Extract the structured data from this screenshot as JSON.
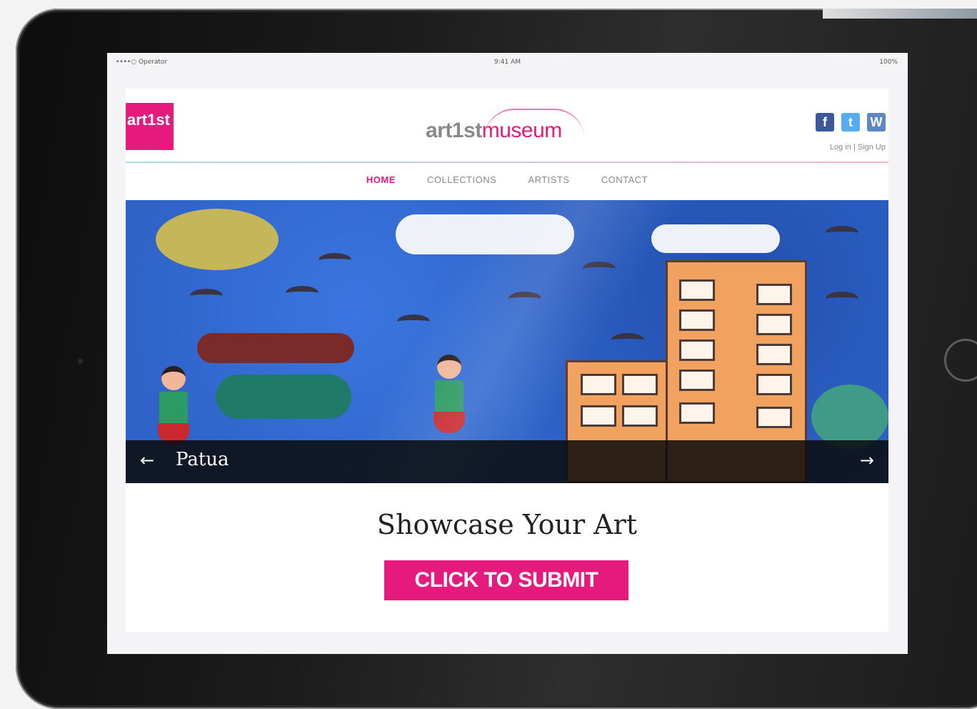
{
  "status_bar": {
    "carrier": "••••○ Operator",
    "time": "9:41 AM",
    "battery": "100%"
  },
  "header": {
    "logo_text": "art1st",
    "brand_part1": "art1st",
    "brand_part2": "museum",
    "social_icons": [
      "facebook-icon",
      "twitter-icon",
      "wordpress-icon"
    ],
    "login_label": "Log in",
    "separator": "|",
    "signup_label": "Sign Up"
  },
  "nav": {
    "items": [
      {
        "label": "HOME",
        "active": true
      },
      {
        "label": "COLLECTIONS",
        "active": false
      },
      {
        "label": "ARTISTS",
        "active": false
      },
      {
        "label": "CONTACT",
        "active": false
      }
    ]
  },
  "hero": {
    "caption": "Patua",
    "prev_icon": "arrow-left-icon",
    "next_icon": "arrow-right-icon"
  },
  "cta": {
    "headline": "Showcase Your Art",
    "button_label": "CLICK TO SUBMIT"
  },
  "colors": {
    "accent": "#e6197d",
    "nav_inactive": "#888888",
    "caption_bg": "#0a0a0a"
  }
}
